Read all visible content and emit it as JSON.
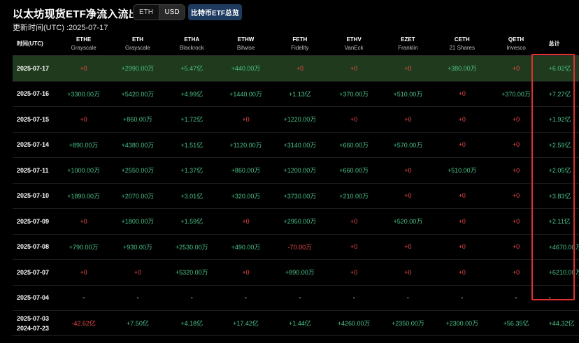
{
  "header": {
    "title": "以太坊现货ETF净流入流出 USD",
    "updated": "更新时间(UTC) :2025-07-17"
  },
  "toggle": {
    "eth_label": "ETH",
    "usd_label": "USD"
  },
  "overview_button": "比特币ETF总览",
  "colors": {
    "positive": "#4cc38a",
    "negative": "#f04a4a",
    "highlight_row": "#1f3a1c",
    "overview_button": "#1e3a5f",
    "annotation_box": "#e03030"
  },
  "table": {
    "date_header": "时间(UTC)",
    "total_header": "总计",
    "columns": [
      {
        "ticker": "ETHE",
        "issuer": "Grayscale"
      },
      {
        "ticker": "ETH",
        "issuer": "Grayscale"
      },
      {
        "ticker": "ETHA",
        "issuer": "Blackrock"
      },
      {
        "ticker": "ETHW",
        "issuer": "Bitwise"
      },
      {
        "ticker": "FETH",
        "issuer": "Fidelity"
      },
      {
        "ticker": "ETHV",
        "issuer": "VanEck"
      },
      {
        "ticker": "EZET",
        "issuer": "Franklin"
      },
      {
        "ticker": "CETH",
        "issuer": "21 Shares"
      },
      {
        "ticker": "QETH",
        "issuer": "Invesco"
      }
    ],
    "rows": [
      {
        "date": "2025-07-17",
        "values": [
          "+0",
          "+2990.00万",
          "+5.47亿",
          "+440.00万",
          "+0",
          "+0",
          "+0",
          "+380.00万",
          "+0"
        ],
        "total": "+6.02亿"
      },
      {
        "date": "2025-07-16",
        "values": [
          "+3300.00万",
          "+5420.00万",
          "+4.99亿",
          "+1440.00万",
          "+1.13亿",
          "+370.00万",
          "+510.00万",
          "+0",
          "+370.00万"
        ],
        "total": "+7.27亿"
      },
      {
        "date": "2025-07-15",
        "values": [
          "+0",
          "+860.00万",
          "+1.72亿",
          "+0",
          "+1220.00万",
          "+0",
          "+0",
          "+0",
          "+0"
        ],
        "total": "+1.92亿"
      },
      {
        "date": "2025-07-14",
        "values": [
          "+890.00万",
          "+4380.00万",
          "+1.51亿",
          "+1120.00万",
          "+3140.00万",
          "+660.00万",
          "+570.00万",
          "+0",
          "+0"
        ],
        "total": "+2.59亿"
      },
      {
        "date": "2025-07-11",
        "values": [
          "+1000.00万",
          "+2550.00万",
          "+1.37亿",
          "+860.00万",
          "+1200.00万",
          "+660.00万",
          "+0",
          "+510.00万",
          "+0"
        ],
        "total": "+2.05亿"
      },
      {
        "date": "2025-07-10",
        "values": [
          "+1890.00万",
          "+2070.00万",
          "+3.01亿",
          "+320.00万",
          "+3730.00万",
          "+210.00万",
          "+0",
          "+0",
          "+0"
        ],
        "total": "+3.83亿"
      },
      {
        "date": "2025-07-09",
        "values": [
          "+0",
          "+1800.00万",
          "+1.59亿",
          "+0",
          "+2950.00万",
          "+0",
          "+520.00万",
          "+0",
          "+0"
        ],
        "total": "+2.11亿"
      },
      {
        "date": "2025-07-08",
        "values": [
          "+790.00万",
          "+930.00万",
          "+2530.00万",
          "+490.00万",
          "-70.00万",
          "+0",
          "+0",
          "+0",
          "+0"
        ],
        "total": "+4670.00万"
      },
      {
        "date": "2025-07-07",
        "values": [
          "+0",
          "+0",
          "+5320.00万",
          "+0",
          "+890.00万",
          "+0",
          "+0",
          "+0",
          "+0"
        ],
        "total": "+6210.00万"
      },
      {
        "date": "2025-07-04",
        "values": [
          "-",
          "-",
          "-",
          "-",
          "-",
          "-",
          "-",
          "-",
          "-"
        ],
        "total": "-"
      }
    ],
    "cumulative": {
      "date_start": "2025-07-03",
      "date_end": "2024-07-23",
      "values": [
        "-42.62亿",
        "+7.50亿",
        "+4.18亿",
        "+17.42亿",
        "+1.44亿",
        "+4260.00万",
        "+2350.00万",
        "+2300.00万",
        "+56.35亿"
      ],
      "total": "+44.32亿"
    }
  }
}
